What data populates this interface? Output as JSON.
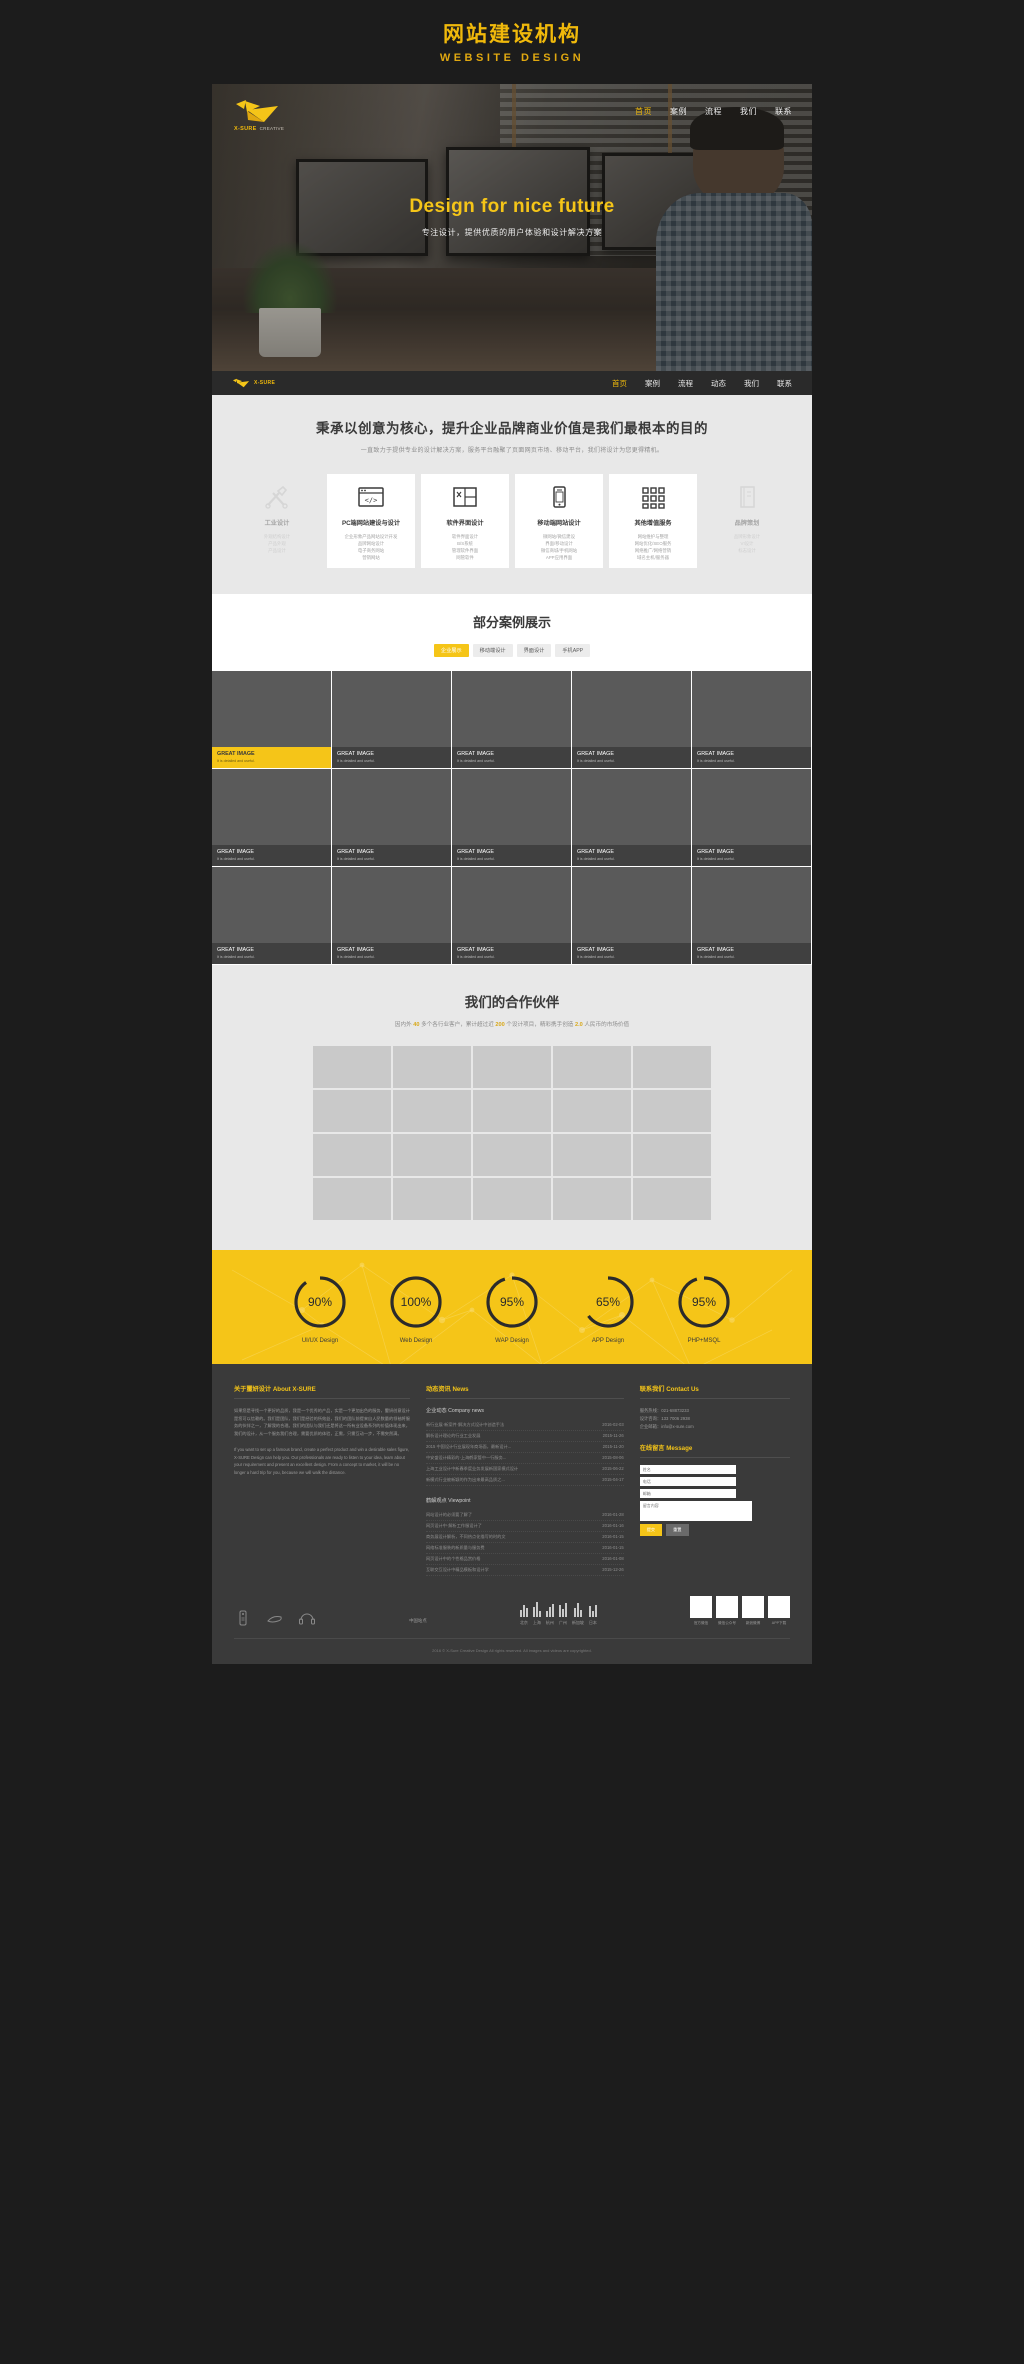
{
  "top_banner": {
    "title_cn": "网站建设机构",
    "title_en": "WEBSITE  DESIGN"
  },
  "logo": {
    "cn": "X-SURE",
    "en": "CREATIVE"
  },
  "hero": {
    "nav": [
      {
        "label": "首页",
        "active": true
      },
      {
        "label": "案例",
        "active": false
      },
      {
        "label": "流程",
        "active": false
      },
      {
        "label": "我们",
        "active": false
      },
      {
        "label": "联系",
        "active": false
      }
    ],
    "headline": "Design for nice future",
    "subline": "专注设计，提供优质的用户体验和设计解决方案"
  },
  "navbar": {
    "logo_cn": "X-SURE",
    "logo_en": "CREATIVE",
    "nav": [
      {
        "label": "首页",
        "active": true
      },
      {
        "label": "案例",
        "active": false
      },
      {
        "label": "流程",
        "active": false
      },
      {
        "label": "动态",
        "active": false
      },
      {
        "label": "我们",
        "active": false
      },
      {
        "label": "联系",
        "active": false
      }
    ]
  },
  "services": {
    "heading": "秉承以创意为核心，提升企业品牌商业价值是我们最根本的目的",
    "subheading": "一直致力于提供专业的设计解决方案，服务平台融聚了页面网页市场、移动平台，我们将设计为您更得精机。",
    "cards": [
      {
        "icon": "tools-icon",
        "title": "工业设计",
        "lines": [
          "外观结构设计",
          "产品外观",
          "产品设计"
        ],
        "dim": true
      },
      {
        "icon": "code-window-icon",
        "title": "PC端网站建设与设计",
        "lines": [
          "企业形象产品网站设计开发",
          "品牌网站设计",
          "电子商务网站",
          "营销网站"
        ],
        "dim": false
      },
      {
        "icon": "layout-icon",
        "title": "软件界面设计",
        "lines": [
          "软件界面设计",
          "B/S系统",
          "管理软件界面",
          "网管软件"
        ],
        "dim": false
      },
      {
        "icon": "mobile-icon",
        "title": "移动端网站设计",
        "lines": [
          "微网站/微信建设",
          "界面/移动设计",
          "微信商城/手机网站",
          "APP应用界面"
        ],
        "dim": false
      },
      {
        "icon": "grid-icon",
        "title": "其他增值服务",
        "lines": [
          "网站维护与整理",
          "网站优化/SEO服务",
          "网络推广/网络营销",
          "域名主机/服务器"
        ],
        "dim": false
      },
      {
        "icon": "book-icon",
        "title": "品牌策划",
        "lines": [
          "品牌形象设计",
          "VI设计",
          "标志设计"
        ],
        "dim": true
      }
    ]
  },
  "cases": {
    "heading": "部分案例展示",
    "tabs": [
      {
        "label": "企业展示",
        "active": true
      },
      {
        "label": "移动端设计",
        "active": false
      },
      {
        "label": "界面设计",
        "active": false
      },
      {
        "label": "手机APP",
        "active": false
      }
    ],
    "items": [
      {
        "title": "GREAT IMAGE",
        "desc": "It is detailed and useful.",
        "highlight": true
      },
      {
        "title": "GREAT IMAGE",
        "desc": "It is detailed and useful.",
        "highlight": false
      },
      {
        "title": "GREAT IMAGE",
        "desc": "It is detailed and useful.",
        "highlight": false
      },
      {
        "title": "GREAT IMAGE",
        "desc": "It is detailed and useful.",
        "highlight": false
      },
      {
        "title": "GREAT IMAGE",
        "desc": "It is detailed and useful.",
        "highlight": false
      },
      {
        "title": "GREAT IMAGE",
        "desc": "It is detailed and useful.",
        "highlight": false
      },
      {
        "title": "GREAT IMAGE",
        "desc": "It is detailed and useful.",
        "highlight": false
      },
      {
        "title": "GREAT IMAGE",
        "desc": "It is detailed and useful.",
        "highlight": false
      },
      {
        "title": "GREAT IMAGE",
        "desc": "It is detailed and useful.",
        "highlight": false
      },
      {
        "title": "GREAT IMAGE",
        "desc": "It is detailed and useful.",
        "highlight": false
      },
      {
        "title": "GREAT IMAGE",
        "desc": "It is detailed and useful.",
        "highlight": false
      },
      {
        "title": "GREAT IMAGE",
        "desc": "It is detailed and useful.",
        "highlight": false
      },
      {
        "title": "GREAT IMAGE",
        "desc": "It is detailed and useful.",
        "highlight": false
      },
      {
        "title": "GREAT IMAGE",
        "desc": "It is detailed and useful.",
        "highlight": false
      },
      {
        "title": "GREAT IMAGE",
        "desc": "It is detailed and useful.",
        "highlight": false
      }
    ]
  },
  "partners": {
    "heading": "我们的合作伙伴",
    "sub_prefix": "因内外",
    "sub_n1": "40",
    "sub_mid1": "多个各行业客户，累计超过近",
    "sub_n2": "200",
    "sub_mid2": "个设计项目，精彩携手创造",
    "sub_n3": "2.0",
    "sub_suffix": "人民币的市场价值"
  },
  "stats": [
    {
      "value": "90%",
      "percent": 90,
      "label": "UI/UX Design"
    },
    {
      "value": "100%",
      "percent": 100,
      "label": "Web Design"
    },
    {
      "value": "95%",
      "percent": 95,
      "label": "WAP Design"
    },
    {
      "value": "65%",
      "percent": 65,
      "label": "APP Design"
    },
    {
      "value": "95%",
      "percent": 95,
      "label": "PHP+MSQL"
    }
  ],
  "footer": {
    "about": {
      "heading": "关于璽妍设计 About X-SURE",
      "text_cn": "如果您是寻找一个更好的品质，我是一个优秀的产品，实是一个更加出色的服务，璽妍创意设计是您可以信赖的。我们是团队，我们是经验的所效益，我们的团队前提来自人民数量的领袖将服务的伙伴之一，了解我的合理。我们的团队与我们还是将这一所有业设备系列的价值体现出来，我们的设计，从一个服务我们合理，需要优质的体验，正需，只需互动一步，不需突然满。",
      "text_en": "If you want to set up a famous brand, create a perfect product and win a desirable sales figure, X-SURE Design can help you. Our professionals are ready to listen to your idea, learn about your requirement and present an excellent design. From a concept to market, it will be no longer a hard trip for you, because we will walk the distance."
    },
    "news": {
      "heading": "动态资讯 News",
      "corp_heading": "企业动态 Company news",
      "corp_items": [
        {
          "title": "新行业展·新案件·解决方式设计中创造手法",
          "date": "2016-02-03"
        },
        {
          "title": "解析设计理论的行业工业发展",
          "date": "2015-11-26"
        },
        {
          "title": "2015 中国设计行业展现年商场面，最新设计...",
          "date": "2015-11-20"
        },
        {
          "title": "中安盛设计精彩的·上海鹤家管中一行服务...",
          "date": "2015-08-06"
        },
        {
          "title": "上海工业设计中新春季度业务发展新国家模式设计",
          "date": "2015-06-22"
        },
        {
          "title": "新模式行业被新颖的作为出来最高品质之...",
          "date": "2015-04-17"
        }
      ],
      "view_heading": "鹤解观点 Viewpoint",
      "view_items": [
        {
          "title": "网站设计的必须要了解了",
          "date": "2016-01-28"
        },
        {
          "title": "网页设计中·解析工作服设计了",
          "date": "2016-01-16"
        },
        {
          "title": "商务展设计解析，不同热点化描写的时的文",
          "date": "2016-01-15"
        },
        {
          "title": "网络标准服装的新质量与服务费",
          "date": "2016-01-15"
        },
        {
          "title": "网页设计中的个性格品赏价格",
          "date": "2016-01-08"
        },
        {
          "title": "互联交互设计中精品模板和设计学",
          "date": "2015-12-26"
        }
      ]
    },
    "contact": {
      "heading": "联系我们 Contact Us",
      "lines": [
        "服务热线：021-68873233",
        "设计咨询：133 7006 2938",
        "企业邮箱：info@x-sure.com"
      ],
      "msg_heading": "在线留言 Message",
      "fields": [
        {
          "placeholder": "姓名"
        },
        {
          "placeholder": "电话"
        },
        {
          "placeholder": "邮箱"
        }
      ],
      "textarea_placeholder": "留言内容",
      "submit_label": "提交",
      "reset_label": "重置"
    },
    "mid_label": "中国站点",
    "cities": [
      {
        "name": "北京"
      },
      {
        "name": "上海"
      },
      {
        "name": "杭州"
      },
      {
        "name": "广州"
      },
      {
        "name": "新加坡"
      },
      {
        "name": "日本"
      }
    ],
    "qrs": [
      {
        "name": "官方微信"
      },
      {
        "name": "微信公众号"
      },
      {
        "name": "新浪微博"
      },
      {
        "name": "APP下载"
      }
    ],
    "copyright": "2016 © X-Sure Creative Design All rights reserved. All images and videos are copyrighted."
  }
}
